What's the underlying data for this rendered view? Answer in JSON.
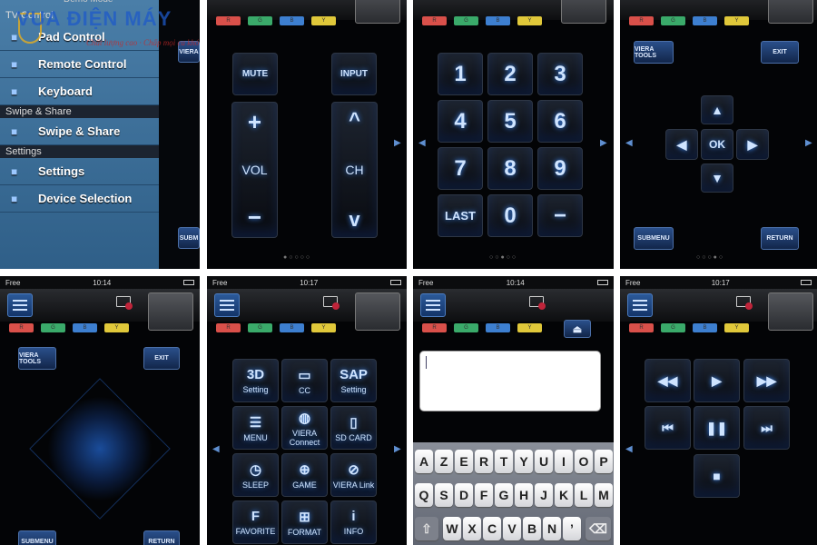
{
  "status_bar": {
    "carrier": "Free",
    "times": [
      "10:14",
      "10:17",
      "10:14",
      "10:17"
    ]
  },
  "color_buttons": [
    "R",
    "G",
    "B",
    "Y"
  ],
  "colors": {
    "red": "#d9504a",
    "green": "#3aaa6a",
    "blue": "#3d7fd0",
    "yellow": "#e0c83a",
    "accent": "#3d8dff"
  },
  "side_menu": {
    "header": "Demo Mode",
    "sections": [
      {
        "title": "TV Control",
        "items": [
          {
            "label": "Pad Control",
            "icon": "touch-icon"
          },
          {
            "label": "Remote Control",
            "icon": "remote-icon"
          },
          {
            "label": "Keyboard",
            "icon": "keyboard-icon"
          }
        ]
      },
      {
        "title": "Swipe & Share",
        "items": [
          {
            "label": "Swipe & Share",
            "icon": "share-icon"
          }
        ]
      },
      {
        "title": "Settings",
        "items": [
          {
            "label": "Settings",
            "icon": "wrench-icon"
          },
          {
            "label": "Device Selection",
            "icon": "tv-icon"
          }
        ]
      }
    ],
    "peek_buttons": [
      "VIERA",
      "SUBM"
    ]
  },
  "remote": {
    "mute": "MUTE",
    "input": "INPUT",
    "vol": "VOL",
    "ch": "CH",
    "plus": "+",
    "minus": "−",
    "up": "^",
    "down": "v"
  },
  "numpad": [
    "1",
    "2",
    "3",
    "4",
    "5",
    "6",
    "7",
    "8",
    "9",
    "LAST",
    "0",
    "−"
  ],
  "dpad": {
    "tools": "VIERA TOOLS",
    "exit": "EXIT",
    "ok": "OK",
    "submenu": "SUBMENU",
    "return": "RETURN"
  },
  "function_grid": [
    {
      "label": "Setting",
      "icon": "3d-icon",
      "glyph": "3D"
    },
    {
      "label": "CC",
      "icon": "cc-icon",
      "glyph": "▭"
    },
    {
      "label": "Setting",
      "icon": "sap-icon",
      "glyph": "SAP"
    },
    {
      "label": "MENU",
      "icon": "list-icon",
      "glyph": "☰"
    },
    {
      "label": "VIERA Connect",
      "icon": "globe-icon",
      "glyph": "◍"
    },
    {
      "label": "SD CARD",
      "icon": "sd-card-icon",
      "glyph": "▯"
    },
    {
      "label": "SLEEP",
      "icon": "clock-icon",
      "glyph": "◷"
    },
    {
      "label": "GAME",
      "icon": "gamepad-icon",
      "glyph": "⊕"
    },
    {
      "label": "VIERA Link",
      "icon": "link-icon",
      "glyph": "⊘"
    },
    {
      "label": "FAVORITE",
      "icon": "favorite-icon",
      "glyph": "F"
    },
    {
      "label": "FORMAT",
      "icon": "format-icon",
      "glyph": "⊞"
    },
    {
      "label": "INFO",
      "icon": "info-icon",
      "glyph": "i"
    }
  ],
  "keyboard": {
    "rows": [
      [
        "A",
        "Z",
        "E",
        "R",
        "T",
        "Y",
        "U",
        "I",
        "O",
        "P"
      ],
      [
        "Q",
        "S",
        "D",
        "F",
        "G",
        "H",
        "J",
        "K",
        "L",
        "M"
      ],
      [
        "W",
        "X",
        "C",
        "V",
        "B",
        "N",
        "’"
      ]
    ],
    "text_value": ""
  },
  "media": [
    {
      "name": "rewind",
      "glyph": "◀◀"
    },
    {
      "name": "play",
      "glyph": "▶"
    },
    {
      "name": "fast-forward",
      "glyph": "▶▶"
    },
    {
      "name": "previous",
      "glyph": "⏮"
    },
    {
      "name": "pause",
      "glyph": "❚❚"
    },
    {
      "name": "next",
      "glyph": "⏭"
    },
    {
      "name": "stop",
      "glyph": "■"
    }
  ],
  "watermark": {
    "brand": "VUA ĐIỆN MÁY",
    "slogan": "Chất lượng cao · Chấp mọi ca khó"
  }
}
